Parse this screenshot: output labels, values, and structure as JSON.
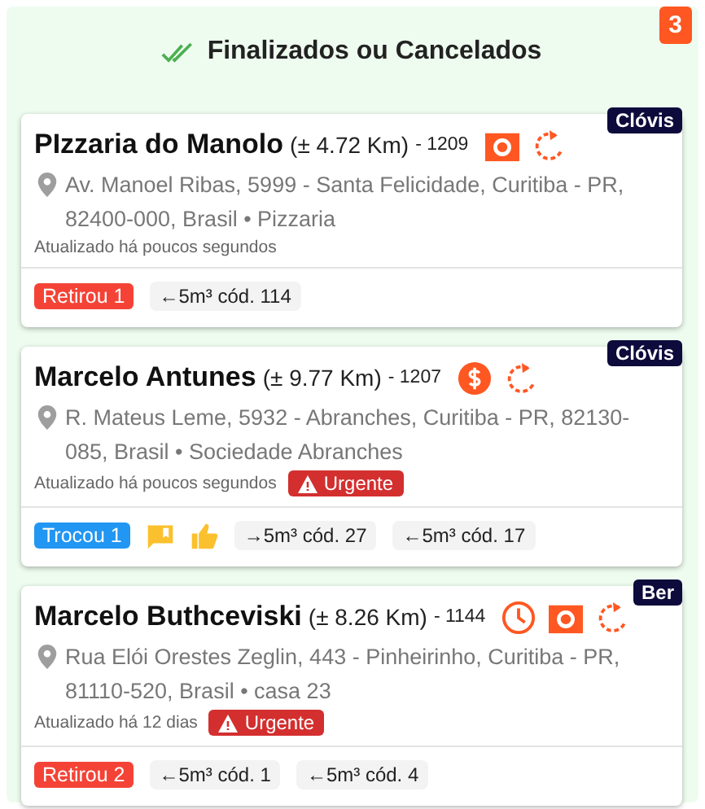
{
  "panel": {
    "title": "Finalizados ou Cancelados",
    "count": "3"
  },
  "cards": [
    {
      "assignee": "Clóvis",
      "name": "PIzzaria do Manolo",
      "distance": "(± 4.72 Km)",
      "code": "- 1209",
      "icons": [
        {
          "kind": "camera"
        },
        {
          "kind": "refresh"
        }
      ],
      "address": "Av. Manoel Ribas, 5999 - Santa Felicidade, Curitiba - PR, 82400-000, Brasil • Pizzaria",
      "updated": "Atualizado há poucos segundos",
      "urgent": false,
      "status": {
        "kind": "retirou",
        "label": "Retirou 1"
      },
      "containers": [
        "←5m³ cód. 114"
      ]
    },
    {
      "assignee": "Clóvis",
      "name": "Marcelo Antunes",
      "distance": "(± 9.77 Km)",
      "code": "- 1207",
      "icons": [
        {
          "kind": "dollar"
        },
        {
          "kind": "refresh"
        }
      ],
      "address": "R. Mateus Leme, 5932 - Abranches, Curitiba - PR, 82130-085, Brasil • Sociedade Abranches",
      "updated": "Atualizado há poucos segundos",
      "urgent": true,
      "urgent_label": "Urgente",
      "status": {
        "kind": "trocou",
        "label": "Trocou 1"
      },
      "extras": [
        {
          "kind": "comment"
        },
        {
          "kind": "thumb"
        }
      ],
      "containers": [
        "→5m³ cód. 27",
        "←5m³ cód. 17"
      ]
    },
    {
      "assignee": "Ber",
      "name": "Marcelo Buthceviski",
      "distance": "(± 8.26 Km)",
      "code": "- 1144",
      "icons": [
        {
          "kind": "clock"
        },
        {
          "kind": "camera"
        },
        {
          "kind": "refresh"
        }
      ],
      "address": "Rua Elói Orestes Zeglin, 443 - Pinheirinho, Curitiba - PR, 81110-520, Brasil • casa 23",
      "updated": "Atualizado há 12 dias",
      "urgent": true,
      "urgent_label": "Urgente",
      "status": {
        "kind": "retirou",
        "label": "Retirou 2"
      },
      "containers": [
        "←5m³ cód. 1",
        "←5m³ cód. 4"
      ]
    }
  ]
}
